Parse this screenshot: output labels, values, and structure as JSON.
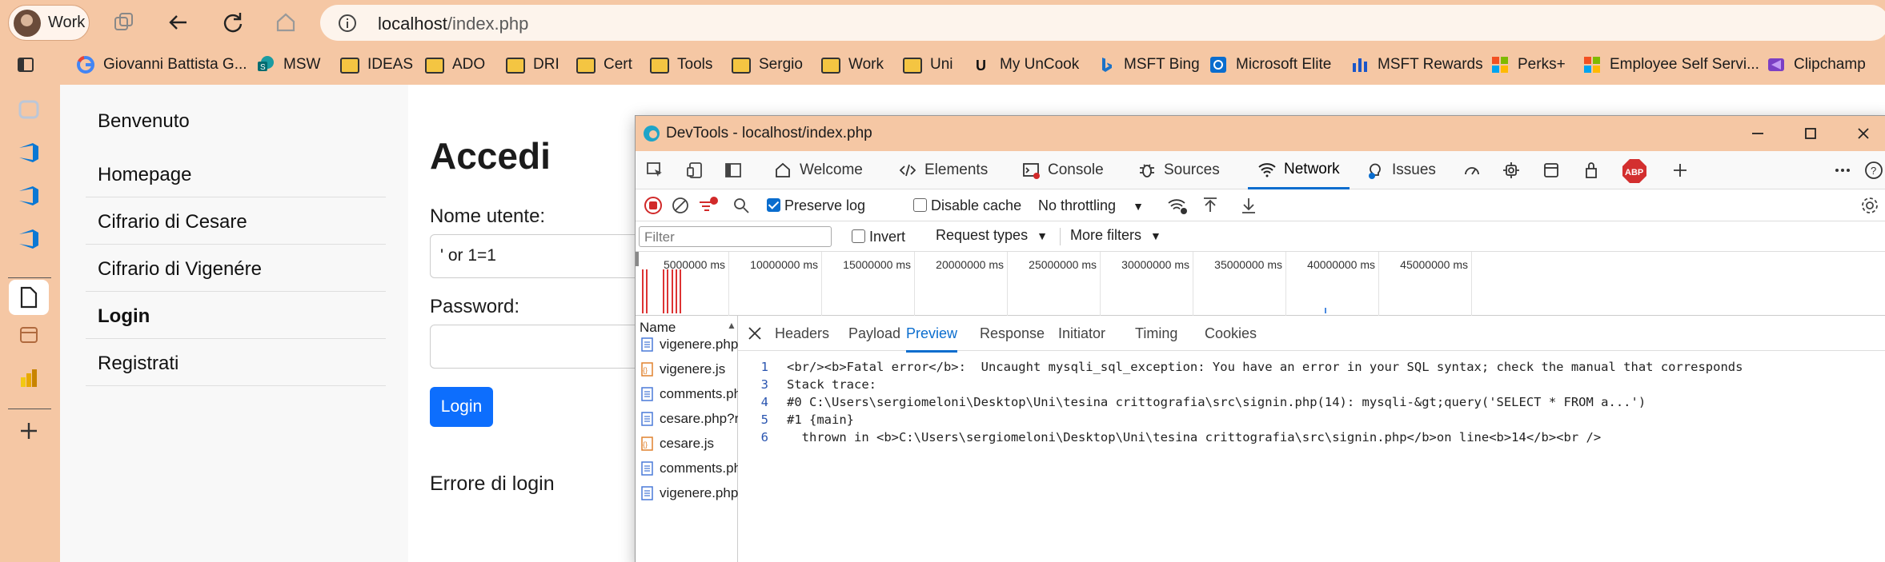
{
  "browser": {
    "profile_label": "Work",
    "address": {
      "host": "localhost",
      "path": "/index.php"
    }
  },
  "bookmarks": [
    {
      "label": "Giovanni Battista G...",
      "icon": "google-icon"
    },
    {
      "label": "MSW",
      "icon": "sharepoint-icon"
    },
    {
      "label": "IDEAS",
      "icon": "folder-icon"
    },
    {
      "label": "ADO",
      "icon": "folder-icon"
    },
    {
      "label": "DRI",
      "icon": "folder-icon"
    },
    {
      "label": "Cert",
      "icon": "folder-icon"
    },
    {
      "label": "Tools",
      "icon": "folder-icon"
    },
    {
      "label": "Sergio",
      "icon": "folder-icon"
    },
    {
      "label": "Work",
      "icon": "folder-icon"
    },
    {
      "label": "Uni",
      "icon": "folder-icon"
    },
    {
      "label": "My UnCook",
      "icon": "u-icon"
    },
    {
      "label": "MSFT Bing",
      "icon": "bing-icon"
    },
    {
      "label": "Microsoft Elite",
      "icon": "elite-icon"
    },
    {
      "label": "MSFT Rewards",
      "icon": "rewards-icon"
    },
    {
      "label": "Perks+",
      "icon": "microsoft-icon"
    },
    {
      "label": "Employee Self Servi...",
      "icon": "microsoft-icon"
    },
    {
      "label": "Clipchamp",
      "icon": "clipchamp-icon"
    }
  ],
  "site": {
    "nav": [
      "Benvenuto",
      "Homepage",
      "Cifrario di Cesare",
      "Cifrario di Vigenére",
      "Login",
      "Registrati"
    ],
    "title": "Accedi",
    "username_label": "Nome utente:",
    "username_value": "' or 1=1",
    "password_label": "Password:",
    "login_button": "Login",
    "error": "Errore di login"
  },
  "devtools": {
    "title": "DevTools - localhost/index.php",
    "tabs": [
      "Welcome",
      "Elements",
      "Console",
      "Sources",
      "Network",
      "Issues"
    ],
    "preserve_log": "Preserve log",
    "disable_cache": "Disable cache",
    "throttling": "No throttling",
    "filter_placeholder": "Filter",
    "invert": "Invert",
    "request_types": "Request types",
    "more_filters": "More filters",
    "timeline_ticks": [
      "5000000 ms",
      "10000000 ms",
      "15000000 ms",
      "20000000 ms",
      "25000000 ms",
      "30000000 ms",
      "35000000 ms",
      "40000000 ms",
      "45000000 ms"
    ],
    "name_header": "Name",
    "requests": [
      {
        "name": "vigenere.php?r...",
        "type": "doc"
      },
      {
        "name": "vigenere.js",
        "type": "js"
      },
      {
        "name": "comments.php...",
        "type": "doc"
      },
      {
        "name": "cesare.php?rn...",
        "type": "doc"
      },
      {
        "name": "cesare.js",
        "type": "js"
      },
      {
        "name": "comments.php...",
        "type": "doc"
      },
      {
        "name": "vigenere.php?r...",
        "type": "doc"
      }
    ],
    "detail_tabs": [
      "Headers",
      "Payload",
      "Preview",
      "Response",
      "Initiator",
      "Timing",
      "Cookies"
    ],
    "preview_lines": [
      {
        "n": "1",
        "text": "<br/><b>Fatal error</b>:  Uncaught mysqli_sql_exception: You have an error in your SQL syntax; check the manual that corresponds"
      },
      {
        "n": "3",
        "text": "Stack trace:"
      },
      {
        "n": "4",
        "text": "#0 C:\\Users\\sergiomeloni\\Desktop\\Uni\\tesina crittografia\\src\\signin.php(14): mysqli-&gt;query('SELECT * FROM a...')"
      },
      {
        "n": "5",
        "text": "#1 {main}"
      },
      {
        "n": "6",
        "text": "  thrown in <b>C:\\Users\\sergiomeloni\\Desktop\\Uni\\tesina crittografia\\src\\signin.php</b>on line<b>14</b><br />"
      }
    ],
    "abp_label": "ABP"
  }
}
